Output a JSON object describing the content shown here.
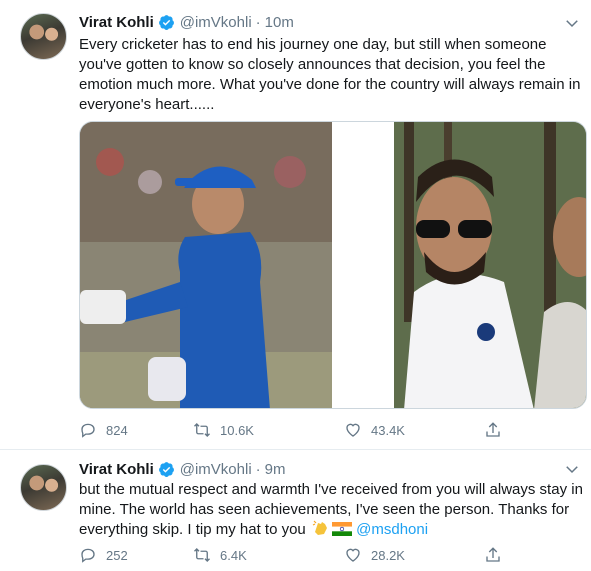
{
  "tweets": [
    {
      "author_name": "Virat Kohli",
      "handle": "@imVkohli",
      "separator": "·",
      "time": "10m",
      "text": "Every cricketer has to end his journey one day, but still when someone you've gotten to know so closely announces that decision, you feel the emotion much more. What you've done for the country will always remain in everyone's heart......",
      "replies": "824",
      "retweets": "10.6K",
      "likes": "43.4K"
    },
    {
      "author_name": "Virat Kohli",
      "handle": "@imVkohli",
      "separator": "·",
      "time": "9m",
      "text": "but the mutual respect and warmth I've received from you will always stay in mine. The world has seen achievements, I've seen the person. Thanks for everything skip. I tip my hat to you",
      "mention": "@msdhoni",
      "replies": "252",
      "retweets": "6.4K",
      "likes": "28.2K"
    }
  ],
  "icons": {
    "verified": "verified-badge-icon",
    "caret": "chevron-down-icon",
    "reply": "reply-icon",
    "retweet": "retweet-icon",
    "like": "heart-icon",
    "share": "share-icon",
    "clap": "clapping-hands-emoji",
    "flag": "india-flag-emoji"
  },
  "colors": {
    "accent": "#1da1f2",
    "text": "#14171a",
    "muted": "#657786",
    "border": "#e6ecf0"
  }
}
